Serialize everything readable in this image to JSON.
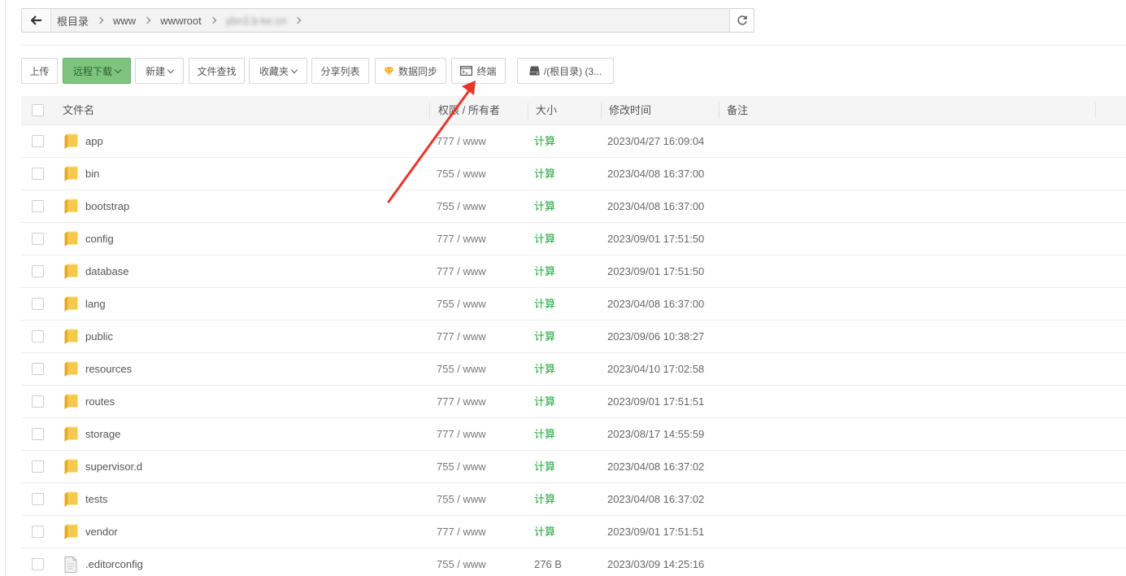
{
  "breadcrumb": {
    "items": [
      "根目录",
      "www",
      "wwwroot",
      "ybn3.b-ke.cn"
    ]
  },
  "toolbar": {
    "upload": "上传",
    "remote_download": "远程下载",
    "new": "新建",
    "file_search": "文件查找",
    "favorites": "收藏夹",
    "share_list": "分享列表",
    "data_sync": "数据同步",
    "terminal": "终端",
    "disk": "/(根目录) (3..."
  },
  "table": {
    "headers": {
      "name": "文件名",
      "perm_owner": "权限 / 所有者",
      "size": "大小",
      "mtime": "修改时间",
      "note": "备注"
    },
    "rows": [
      {
        "name": "app",
        "type": "folder",
        "perm": "777 / www",
        "size": "计算",
        "mtime": "2023/04/27 16:09:04"
      },
      {
        "name": "bin",
        "type": "folder",
        "perm": "755 / www",
        "size": "计算",
        "mtime": "2023/04/08 16:37:00"
      },
      {
        "name": "bootstrap",
        "type": "folder",
        "perm": "755 / www",
        "size": "计算",
        "mtime": "2023/04/08 16:37:00"
      },
      {
        "name": "config",
        "type": "folder",
        "perm": "777 / www",
        "size": "计算",
        "mtime": "2023/09/01 17:51:50"
      },
      {
        "name": "database",
        "type": "folder",
        "perm": "777 / www",
        "size": "计算",
        "mtime": "2023/09/01 17:51:50"
      },
      {
        "name": "lang",
        "type": "folder",
        "perm": "755 / www",
        "size": "计算",
        "mtime": "2023/04/08 16:37:00"
      },
      {
        "name": "public",
        "type": "folder",
        "perm": "777 / www",
        "size": "计算",
        "mtime": "2023/09/06 10:38:27"
      },
      {
        "name": "resources",
        "type": "folder",
        "perm": "755 / www",
        "size": "计算",
        "mtime": "2023/04/10 17:02:58"
      },
      {
        "name": "routes",
        "type": "folder",
        "perm": "777 / www",
        "size": "计算",
        "mtime": "2023/09/01 17:51:51"
      },
      {
        "name": "storage",
        "type": "folder",
        "perm": "777 / www",
        "size": "计算",
        "mtime": "2023/08/17 14:55:59"
      },
      {
        "name": "supervisor.d",
        "type": "folder",
        "perm": "755 / www",
        "size": "计算",
        "mtime": "2023/04/08 16:37:02"
      },
      {
        "name": "tests",
        "type": "folder",
        "perm": "755 / www",
        "size": "计算",
        "mtime": "2023/04/08 16:37:02"
      },
      {
        "name": "vendor",
        "type": "folder",
        "perm": "777 / www",
        "size": "计算",
        "mtime": "2023/09/01 17:51:51"
      },
      {
        "name": ".editorconfig",
        "type": "file",
        "perm": "755 / www",
        "size": "276 B",
        "mtime": "2023/03/09 14:25:16"
      }
    ]
  },
  "colors": {
    "accent_green": "#20a53a",
    "button_green": "#7ec47f",
    "folder_yellow": "#f6c94a",
    "annotation_red": "#e8352b"
  },
  "icons": {
    "back": "arrow-left-icon",
    "refresh": "refresh-icon",
    "data_sync": "diamond-icon",
    "terminal": "terminal-icon",
    "disk": "hard-drive-icon",
    "folder": "folder-icon",
    "file": "file-icon"
  }
}
